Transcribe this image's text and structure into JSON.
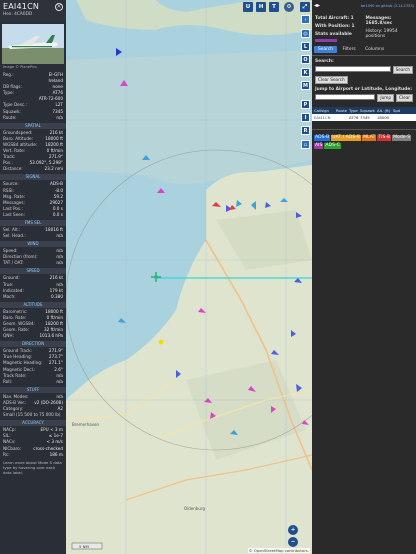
{
  "aircraft": {
    "callsign": "EAI41CN",
    "hex_line": "Hex: 4CA0DD",
    "photo_credit": "Image © PlanePics"
  },
  "details": [
    {
      "k": "Reg.:",
      "v": "EI-GFH"
    },
    {
      "k": "",
      "v": "Ireland"
    },
    {
      "k": "DB flags:",
      "v": "none"
    },
    {
      "k": "Type:",
      "v": "AT76"
    },
    {
      "k": "",
      "v": "ATR-72-600"
    },
    {
      "k": "Type Desc.:",
      "v": "L2T"
    },
    {
      "k": "Squawk:",
      "v": "7345"
    },
    {
      "k": "Route:",
      "v": "n/a"
    }
  ],
  "sections": [
    {
      "title": "SPATIAL",
      "rows": [
        {
          "k": "Groundspeed:",
          "v": "216 kt"
        },
        {
          "k": "Baro. Altitude:",
          "v": "18000 ft"
        },
        {
          "k": "WGS84 altitude:",
          "v": "18200 ft"
        },
        {
          "k": "Vert. Rate:",
          "v": "0 ft/min"
        },
        {
          "k": "Track:",
          "v": "271.9°"
        },
        {
          "k": "Pos.:",
          "v": "53.092°, 5.298°"
        },
        {
          "k": "Distance:",
          "v": "23.2 nmi"
        }
      ]
    },
    {
      "title": "SIGNAL",
      "rows": [
        {
          "k": "Source:",
          "v": "ADS-B"
        },
        {
          "k": "RSSI:",
          "v": "-8.0"
        },
        {
          "k": "Msg. Rate:",
          "v": "59.2"
        },
        {
          "k": "Messages:",
          "v": "29027"
        },
        {
          "k": "Last Pos.:",
          "v": "0.0 s"
        },
        {
          "k": "Last Seen:",
          "v": "0.0 s"
        }
      ]
    },
    {
      "title": "FMS SEL",
      "rows": [
        {
          "k": "Sel. Alt.:",
          "v": "18016 ft"
        },
        {
          "k": "Sel. Head.:",
          "v": "n/a"
        }
      ]
    },
    {
      "title": "WIND",
      "rows": [
        {
          "k": "Speed:",
          "v": "n/a"
        },
        {
          "k": "Direction (from):",
          "v": "n/a"
        },
        {
          "k": "TAT / OAT:",
          "v": "n/a"
        }
      ]
    },
    {
      "title": "SPEED",
      "rows": [
        {
          "k": "Ground:",
          "v": "216 kt"
        },
        {
          "k": "True:",
          "v": "n/a"
        },
        {
          "k": "Indicated:",
          "v": "179 kt"
        },
        {
          "k": "Mach:",
          "v": "0.380"
        }
      ]
    },
    {
      "title": "ALTITUDE",
      "rows": [
        {
          "k": "Barometric:",
          "v": "18000 ft"
        },
        {
          "k": "Baro. Rate:",
          "v": "0 ft/min"
        },
        {
          "k": "Geom. WGS84:",
          "v": "18200 ft"
        },
        {
          "k": "Geom. Rate:",
          "v": "32 ft/min"
        },
        {
          "k": "QNH:",
          "v": "1013.6 hPa"
        }
      ]
    },
    {
      "title": "DIRECTION",
      "rows": [
        {
          "k": "Ground Track:",
          "v": "271.9°"
        },
        {
          "k": "True Heading:",
          "v": "273.7°"
        },
        {
          "k": "Magnetic Heading:",
          "v": "271.1°"
        },
        {
          "k": "Magnetic Decl.:",
          "v": "2.6°"
        },
        {
          "k": "Track Rate:",
          "v": "n/a"
        },
        {
          "k": "Roll:",
          "v": "n/a"
        }
      ]
    },
    {
      "title": "STUFF",
      "rows": [
        {
          "k": "Nav. Modes:",
          "v": "n/a"
        },
        {
          "k": "ADS-B Ver.:",
          "v": "v2 (DO-260B)"
        },
        {
          "k": "Category:",
          "v": "A2"
        },
        {
          "k": "Small (15 500 to 75 000 lb)",
          "v": ""
        }
      ]
    },
    {
      "title": "ACCURACY",
      "rows": [
        {
          "k": "NACp:",
          "v": "EPU < 3 m"
        },
        {
          "k": "SIL:",
          "v": "≤ 1e-7"
        },
        {
          "k": "NACv:",
          "v": "< 3 m/s"
        },
        {
          "k": "NICbaro:",
          "v": "cross-checked"
        },
        {
          "k": "Rc:",
          "v": "186 m"
        }
      ]
    }
  ],
  "footer_note": "Learn more about Mode S data type by hovering over each data label.",
  "map": {
    "top_buttons": [
      "U",
      "H",
      "T"
    ],
    "side_buttons": [
      "L",
      "O",
      "K",
      "M",
      "P",
      "I",
      "R"
    ],
    "place_label_1": "Bremerhaven",
    "place_label_2": "Oldenburg",
    "scale_label": "5 NM",
    "attribution": "© OpenStreetMap contributors.",
    "zoom_in": "+",
    "zoom_out": "−"
  },
  "right": {
    "link_text": "tar1090 on github (3.14.1753)",
    "total_aircraft": "Total Aircraft: 1",
    "with_position": "With Position: 1",
    "stats": "Stats available",
    "messages": "Messages: 1685.8/sec",
    "history": "History: 19954 positions",
    "tabs": [
      "Search",
      "Filters",
      "Columns"
    ],
    "search_label": "Search:",
    "search_button": "Search",
    "clear_search": "Clear Search",
    "jump_label": "Jump to Airport or Latitude, Longitude:",
    "jump_button": "Jump",
    "clear_button": "Clear",
    "table_headers": [
      "Callsign",
      "Route",
      "Type",
      "Squawk",
      "Alt. (ft)",
      "Spd"
    ],
    "table_row": [
      "EAI41CN",
      "",
      "AT76",
      "7345",
      "18000",
      ""
    ],
    "sources": [
      {
        "label": "ADS-B",
        "color": "#1b6fe0"
      },
      {
        "label": "UAT / ADS-R",
        "color": "#e0a020"
      },
      {
        "label": "MLAT",
        "color": "#e07010"
      },
      {
        "label": "TIS-B",
        "color": "#d03030"
      },
      {
        "label": "Mode-S",
        "color": "#7f7f7f"
      },
      {
        "label": "AIS",
        "color": "#a03ca0"
      },
      {
        "label": "ADS-C",
        "color": "#2ca02c"
      }
    ]
  }
}
